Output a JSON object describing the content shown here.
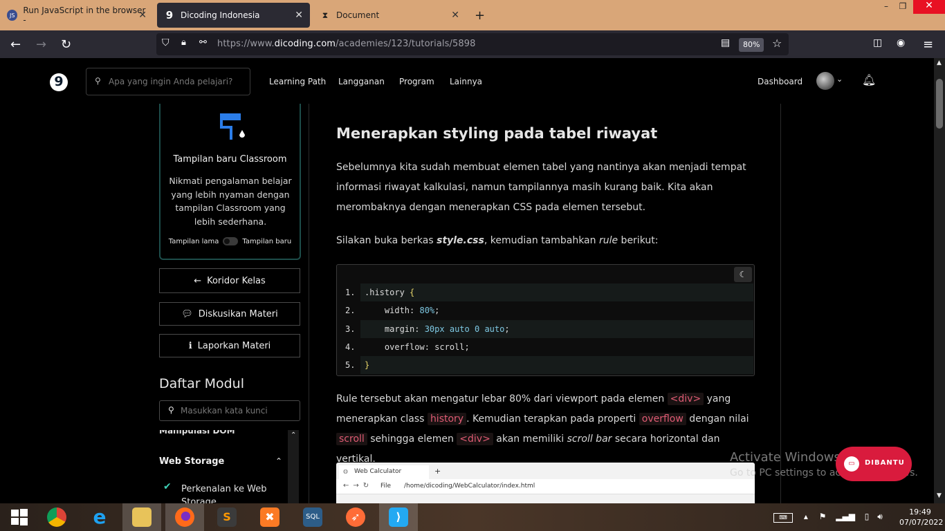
{
  "browser": {
    "tabs": [
      {
        "label": "Run JavaScript in the browser -",
        "icon": "js-icon"
      },
      {
        "label": "Dicoding Indonesia",
        "icon": "dicoding-icon",
        "active": true
      },
      {
        "label": "Document",
        "icon": "hourglass-icon"
      }
    ],
    "url_prefix": "https://www.",
    "url_domain": "dicoding.com",
    "url_path": "/academies/123/tutorials/5898",
    "zoom": "80%"
  },
  "site": {
    "logo": "9",
    "search_placeholder": "Apa yang ingin Anda pelajari?",
    "menu": [
      "Learning Path",
      "Langganan",
      "Program",
      "Lainnya"
    ],
    "dashboard": "Dashboard"
  },
  "sidebar": {
    "classroom_title": "Tampilan baru Classroom",
    "classroom_desc": "Nikmati pengalaman belajar yang lebih nyaman dengan tampilan Classroom yang lebih sederhana.",
    "toggle_old": "Tampilan lama",
    "toggle_new": "Tampilan baru",
    "btn_koridor": "Koridor Kelas",
    "btn_diskusi": "Diskusikan Materi",
    "btn_laporkan": "Laporkan Materi",
    "daftar_modul": "Daftar Modul",
    "module_search_placeholder": "Masukkan kata kunci",
    "module_cut": "Manipulasi DOM",
    "module_section": "Web Storage",
    "module_item": "Perkenalan ke Web Storage"
  },
  "content": {
    "heading": "Menerapkan styling pada tabel riwayat",
    "p1": "Sebelumnya kita sudah membuat elemen tabel yang nantinya akan menjadi tempat informasi riwayat kalkulasi, namun tampilannya masih kurang baik. Kita akan merombaknya dengan menerapkan CSS pada elemen tersebut.",
    "p2_a": "Silakan buka berkas ",
    "p2_file": "style.css",
    "p2_b": ", kemudian tambahkan ",
    "p2_rule": "rule",
    "p2_c": " berikut:",
    "code": [
      {
        "n": "1.",
        "text": ".history {"
      },
      {
        "n": "2.",
        "text": "    width: 80%;"
      },
      {
        "n": "3.",
        "text": "    margin: 30px auto 0 auto;"
      },
      {
        "n": "4.",
        "text": "    overflow: scroll;"
      },
      {
        "n": "5.",
        "text": "}"
      }
    ],
    "p3_a": "Rule tersebut akan mengatur lebar 80% dari viewport pada elemen ",
    "p3_div": "<div>",
    "p3_b": " yang menerapkan class ",
    "p3_history": "history",
    "p3_c": ". Kemudian terapkan pada properti ",
    "p3_overflow": "overflow",
    "p3_d": " dengan nilai ",
    "p3_scroll": "scroll",
    "p3_e": " sehingga elemen ",
    "p3_div2": "<div>",
    "p3_f": " akan memiliki ",
    "p3_scrollbar": "scroll bar",
    "p3_g": " secara horizontal dan vertikal.",
    "shot_tab": "Web Calculator",
    "shot_file": "File",
    "shot_url": "/home/dicoding/WebCalculator/index.html"
  },
  "overlay": {
    "activate_title": "Activate Windows",
    "activate_sub": "Go to PC settings to activate Windows.",
    "dibantu": "DIBANTU"
  },
  "taskbar": {
    "time": "19:49",
    "date": "07/07/2022"
  }
}
